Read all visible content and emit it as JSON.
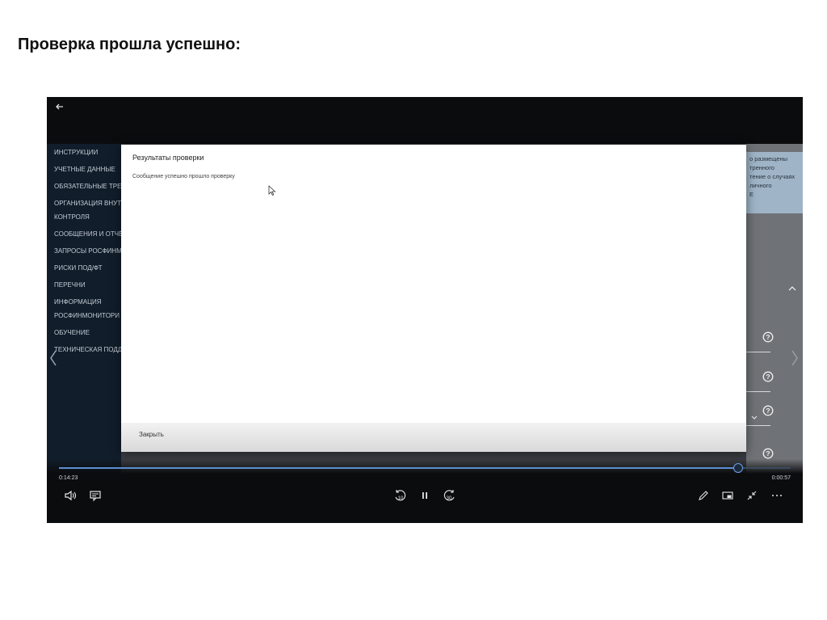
{
  "slide": {
    "title": "Проверка прошла успешно:"
  },
  "app": {
    "sidebar": {
      "items": [
        {
          "label": "ИНСТРУКЦИИ"
        },
        {
          "label": "УЧЕТНЫЕ ДАННЫЕ"
        },
        {
          "label": "ОБЯЗАТЕЛЬНЫЕ ТРЕБ"
        },
        {
          "label": "ОРГАНИЗАЦИЯ ВНУТР"
        },
        {
          "label": "КОНТРОЛЯ"
        },
        {
          "label": "СООБЩЕНИЯ И ОТЧЁ"
        },
        {
          "label": "ЗАПРОСЫ РОСФИНМ"
        },
        {
          "label": "РИСКИ ПОД/ФТ"
        },
        {
          "label": "ПЕРЕЧНИ"
        },
        {
          "label": "ИНФОРМАЦИЯ"
        },
        {
          "label": "РОСФИНМОНИТОРИ"
        },
        {
          "label": "ОБУЧЕНИЕ"
        },
        {
          "label": "ТЕХНИЧЕСКАЯ ПОДД"
        }
      ]
    },
    "info_panel": {
      "lines": [
        "о размещены",
        "тренного",
        "тение о случаях",
        "личного",
        "E"
      ]
    }
  },
  "dialog": {
    "title": "Результаты проверки",
    "message": "Сообщение успешно прошло проверку",
    "close_label": "Закрыть"
  },
  "player": {
    "time_current": "0:14:23",
    "time_remaining": "0:00:57",
    "progress_fraction": 0.928,
    "accent_color": "#5a8fd0"
  }
}
